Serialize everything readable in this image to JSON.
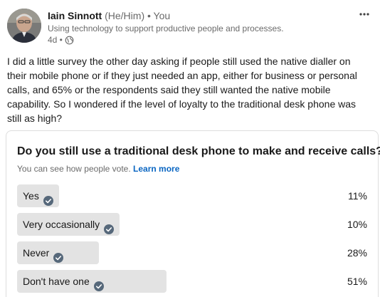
{
  "author": {
    "name": "Iain Sinnott",
    "pronouns": "(He/Him)",
    "connection": "• You",
    "headline": "Using technology to support productive people and processes.",
    "time": "4d •",
    "visibility_icon": "globe-icon",
    "more_icon": "more-icon"
  },
  "post": {
    "text": "I did a little survey the other day asking if people still used the native dialler on their mobile phone or if they just needed an app, either for business or personal calls, and 65% or the respondents said they still wanted the native mobile capability. So I wondered if the level of loyalty to the traditional desk phone was still as high?"
  },
  "poll": {
    "question": "Do you still use a traditional desk phone to make and receive calls?",
    "note": "You can see how people vote.",
    "learn_more": "Learn more",
    "options": [
      {
        "label": "Yes",
        "percent": "11%",
        "share": 11
      },
      {
        "label": "Very occasionally",
        "percent": "10%",
        "share": 10
      },
      {
        "label": "Never",
        "percent": "28%",
        "share": 28
      },
      {
        "label": "Don't have one",
        "percent": "51%",
        "share": 51
      }
    ]
  },
  "colors": {
    "accent": "#0a66c2",
    "check": "#56687a",
    "bar": "#e3e3e3"
  }
}
